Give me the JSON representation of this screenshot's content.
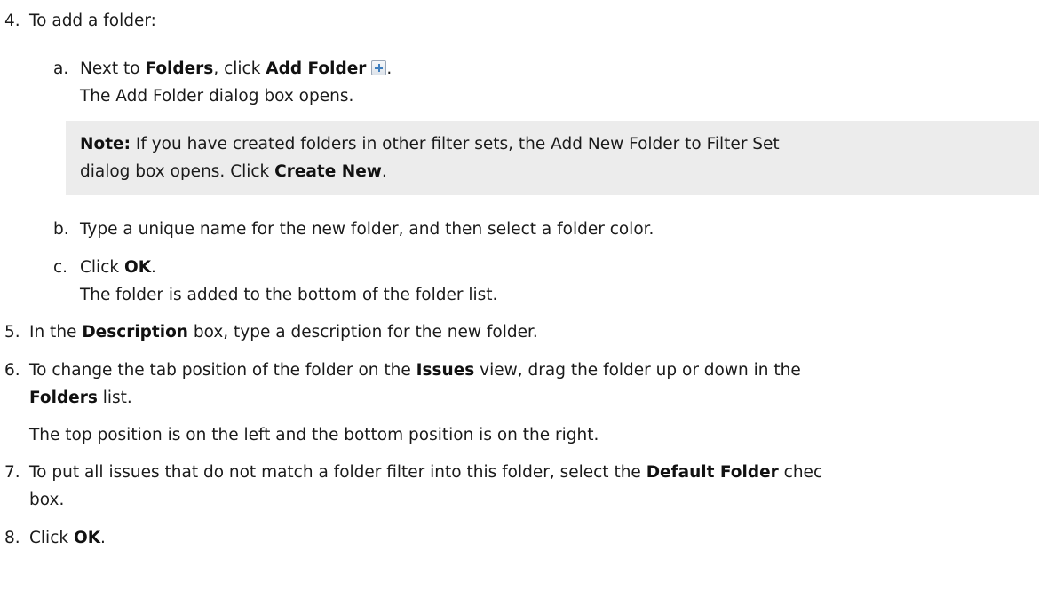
{
  "steps": {
    "s4": {
      "num": "4.",
      "text": "To add a folder:",
      "a": {
        "letter": "a.",
        "pre": "Next to ",
        "folders": "Folders",
        "mid": ", click ",
        "add_folder": "Add Folder",
        "icon": "add-folder-icon",
        "post": ".",
        "result": "The Add Folder dialog box opens."
      },
      "note": {
        "label": "Note:",
        "line1": " If you have created folders in other filter sets, the Add New Folder to Filter Set",
        "line2_pre": "dialog box opens. Click ",
        "create_new": "Create New",
        "line2_post": "."
      },
      "b": {
        "letter": "b.",
        "text": "Type a unique name for the new folder, and then select a folder color."
      },
      "c": {
        "letter": "c.",
        "pre": "Click ",
        "ok": "OK",
        "post": ".",
        "result": "The folder is added to the bottom of the folder list."
      }
    },
    "s5": {
      "num": "5.",
      "pre": "In the ",
      "description": "Description",
      "post": " box, type a description for the new folder."
    },
    "s6": {
      "num": "6.",
      "pre": "To change the tab position of the folder on the ",
      "issues": "Issues",
      "post": " view, drag the folder up or down in the",
      "folders": "Folders",
      "post2": " list.",
      "result": "The top position is on the left and the bottom position is on the right."
    },
    "s7": {
      "num": "7.",
      "pre": "To put all issues that do not match a folder filter into this folder, select the ",
      "default_folder": "Default Folder",
      "post": " chec",
      "line2": "box."
    },
    "s8": {
      "num": "8.",
      "pre": "Click ",
      "ok": "OK",
      "post": "."
    }
  }
}
